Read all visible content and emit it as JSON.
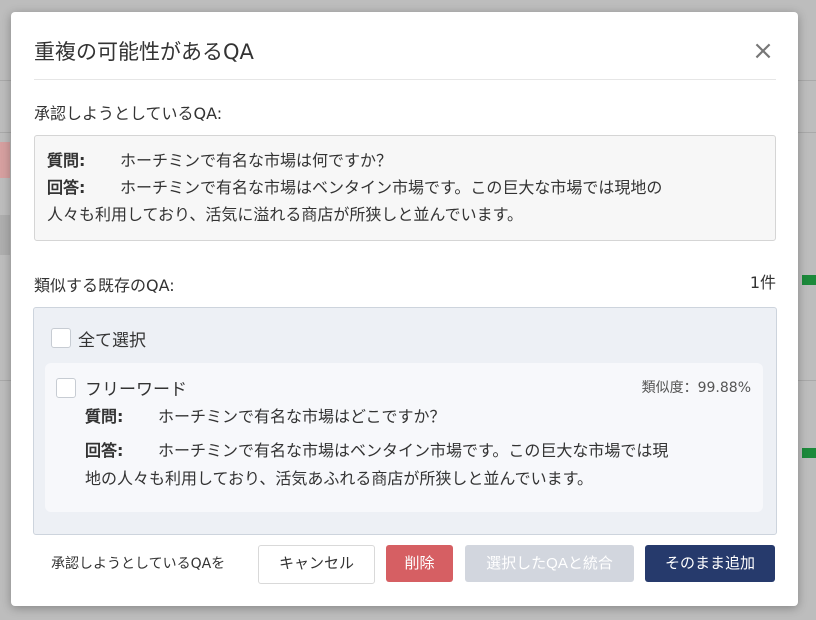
{
  "modal": {
    "title": "重複の可能性があるQA",
    "close_symbol": "×",
    "pending_label": "承認しようとしているQA:",
    "pending": {
      "question_key": "質問:",
      "question": "ホーチミンで有名な市場は何ですか？",
      "answer_key": "回答:",
      "answer_line1": "ホーチミンで有名な市場はベンタイン市場です。この巨大な市場では現地の",
      "answer_line2": "人々も利用しており、活気に溢れる商店が所狭しと並んでいます。"
    },
    "similar_label": "類似する既存のQA:",
    "similar_count": "1件",
    "select_all_label": "全て選択",
    "items": [
      {
        "title": "フリーワード",
        "similarity": "類似度：99.88%",
        "question_key": "質問:",
        "question": "ホーチミンで有名な市場はどこですか？",
        "answer_key": "回答:",
        "answer_line1": "ホーチミンで有名な市場はベンタイン市場です。この巨大な市場では現",
        "answer_line2": "地の人々も利用しており、活気あふれる商店が所狭しと並んでいます。"
      }
    ],
    "footer": {
      "text": "承認しようとしているQAを",
      "cancel_label": "キャンセル",
      "delete_label": "削除",
      "merge_label": "選択したQAと統合",
      "add_label": "そのまま追加"
    }
  }
}
